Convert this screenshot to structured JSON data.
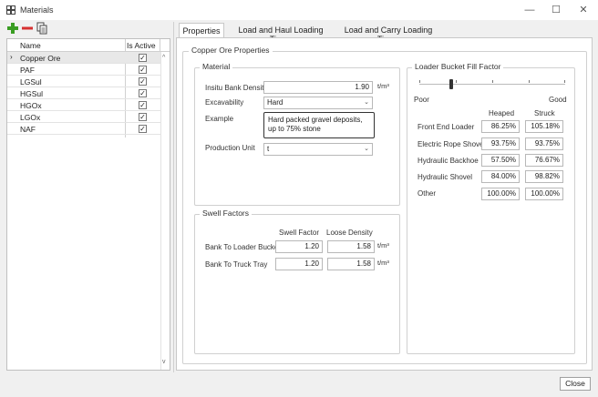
{
  "window": {
    "title": "Materials",
    "min_glyph": "—",
    "max_glyph": "☐",
    "close_glyph": "✕"
  },
  "toolbar": {
    "add_icon": "plus-icon",
    "remove_icon": "minus-icon",
    "copy_icon": "copy-icon",
    "colors": {
      "add": "#3a9d23",
      "remove": "#d63030"
    }
  },
  "list": {
    "headers": {
      "name": "Name",
      "active": "Is Active"
    },
    "rows": [
      {
        "name": "Copper Ore",
        "selected": true
      },
      {
        "name": "PAF"
      },
      {
        "name": "LGSul"
      },
      {
        "name": "HGSul"
      },
      {
        "name": "HGOx"
      },
      {
        "name": "LGOx"
      },
      {
        "name": "NAF"
      }
    ],
    "selected_marker": "›",
    "check_glyph": "✓",
    "scroll_up": "^",
    "scroll_down": "v"
  },
  "tabs": [
    {
      "label": "Properties",
      "active": true
    },
    {
      "label": "Load and Haul Loading Times"
    },
    {
      "label": "Load and Carry Loading Times"
    }
  ],
  "properties": {
    "group_title": "Copper Ore Properties",
    "material": {
      "title": "Material",
      "density_label": "Insitu Bank Density",
      "density_value": "1.90",
      "density_unit": "t/m³",
      "excavability_label": "Excavability",
      "excavability_value": "Hard",
      "example_label": "Example",
      "example_text_line1": "Hard packed gravel deposits,",
      "example_text_line2": "up to 75% stone",
      "production_unit_label": "Production Unit",
      "production_unit_value": "t"
    },
    "swell": {
      "title": "Swell Factors",
      "col_swell": "Swell Factor",
      "col_loose": "Loose Density",
      "rows": [
        {
          "label": "Bank To Loader Bucket",
          "swell": "1.20",
          "loose": "1.58",
          "unit": "t/m³"
        },
        {
          "label": "Bank To Truck Tray",
          "swell": "1.20",
          "loose": "1.58",
          "unit": "t/m³"
        }
      ]
    },
    "bucket": {
      "title": "Loader Bucket Fill Factor",
      "poor_label": "Poor",
      "good_label": "Good",
      "col_heaped": "Heaped",
      "col_struck": "Struck",
      "slider_fraction": 0.22,
      "rows": [
        {
          "label": "Front End Loader",
          "heaped": "86.25%",
          "struck": "105.18%"
        },
        {
          "label": "Electric Rope Shovel",
          "heaped": "93.75%",
          "struck": "93.75%"
        },
        {
          "label": "Hydraulic Backhoe",
          "heaped": "57.50%",
          "struck": "76.67%"
        },
        {
          "label": "Hydraulic Shovel",
          "heaped": "84.00%",
          "struck": "98.82%"
        },
        {
          "label": "Other",
          "heaped": "100.00%",
          "struck": "100.00%"
        }
      ]
    }
  },
  "footer": {
    "close_label": "Close"
  }
}
